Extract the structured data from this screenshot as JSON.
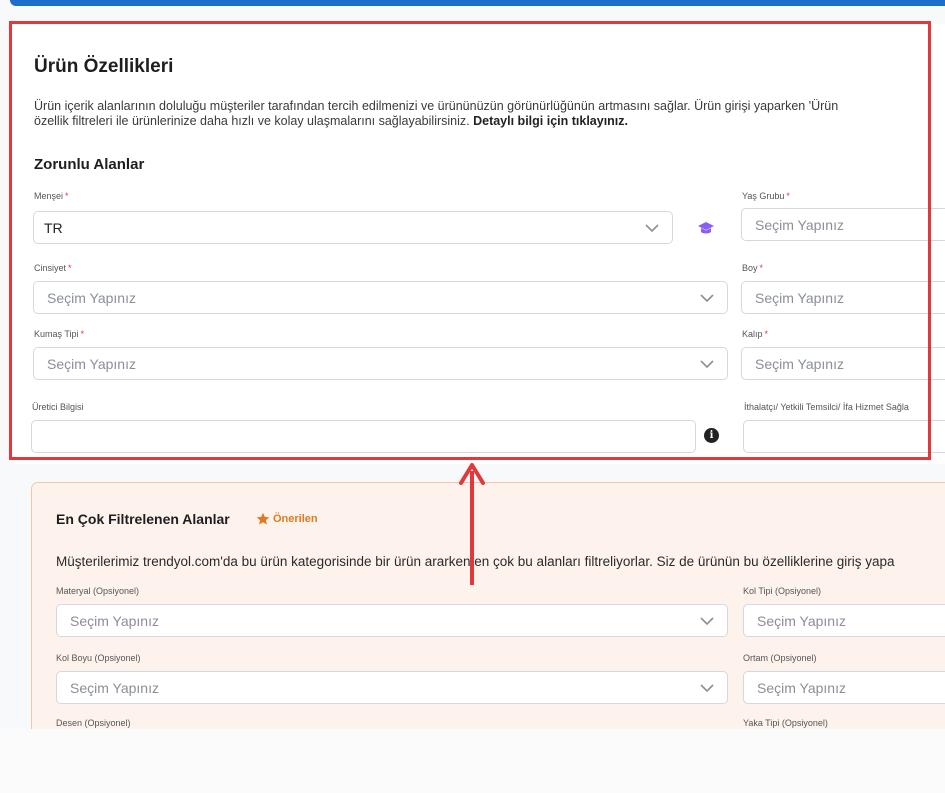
{
  "colors": {
    "accent": "#1d6ec8",
    "highlight": "#e2383b",
    "required": "#e2383b",
    "recommended": "#e07a1f",
    "recommended_bg": "#fdf3ec",
    "grad_icon": "#8b5cf6"
  },
  "icons": {
    "chevron": "chevron-down-icon",
    "graduation": "graduation-cap-icon",
    "info": "info-icon",
    "star": "star-icon",
    "arrow": "up-arrow-annotation"
  },
  "section": {
    "title": "Ürün Özellikleri",
    "desc_line1": "Ürün içerik alanlarının doluluğu müşteriler tarafından tercih edilmenizi ve ürününüzün görünürlüğünün artmasını sağlar. Ürün girişi yaparken 'Ürün",
    "desc_line2": "özellik filtreleri ile ürünlerinize daha hızlı ve kolay ulaşmalarını sağlayabilirsiniz.",
    "desc_link": "Detaylı bilgi için tıklayınız.",
    "subtitle": "Zorunlu Alanlar"
  },
  "required_mark": "*",
  "fields": {
    "mensei": {
      "label": "Menşei",
      "value": "TR"
    },
    "yas_grubu": {
      "label": "Yaş Grubu",
      "placeholder": "Seçim Yapınız"
    },
    "cinsiyet": {
      "label": "Cinsiyet",
      "placeholder": "Seçim Yapınız"
    },
    "boy": {
      "label": "Boy",
      "placeholder": "Seçim Yapınız"
    },
    "kumas_tipi": {
      "label": "Kumaş Tipi",
      "placeholder": "Seçim Yapınız"
    },
    "kalip": {
      "label": "Kalıp",
      "placeholder": "Seçim Yapınız"
    },
    "uretici": {
      "label": "Üretici Bilgisi",
      "value": ""
    },
    "ithalatci": {
      "label": "İthalatçı/ Yetkili Temsilci/ İfa Hizmet Sağla",
      "value": ""
    }
  },
  "recommended": {
    "title": "En Çok Filtrelenen Alanlar",
    "badge": "Önerilen",
    "desc": "Müşterilerimiz trendyol.com'da bu ürün kategorisinde bir ürün ararken en çok bu alanları filtreliyorlar. Siz de ürünün bu özelliklerine giriş yapa",
    "fields": {
      "materyal": {
        "label": "Materyal (Opsiyonel)",
        "placeholder": "Seçim Yapınız"
      },
      "kol_tipi": {
        "label": "Kol Tipi (Opsiyonel)",
        "placeholder": "Seçim Yapınız"
      },
      "kol_boyu": {
        "label": "Kol Boyu (Opsiyonel)",
        "placeholder": "Seçim Yapınız"
      },
      "ortam": {
        "label": "Ortam (Opsiyonel)",
        "placeholder": "Seçim Yapınız"
      },
      "desen": {
        "label": "Desen (Opsiyonel)"
      },
      "yaka_tipi": {
        "label": "Yaka Tipi (Opsiyonel)"
      }
    }
  }
}
